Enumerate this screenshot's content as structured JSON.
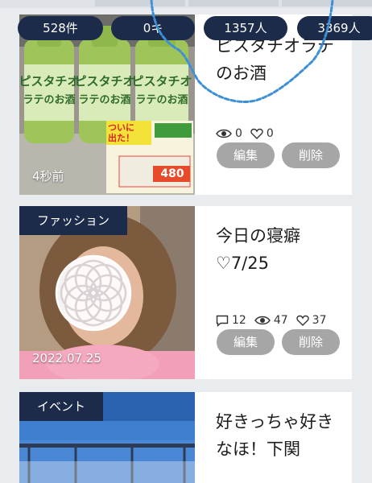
{
  "header_counts": [
    "528件",
    "0キ",
    "1357人",
    "3369人"
  ],
  "posts": [
    {
      "category": "",
      "title": "ピスタチオラテのお酒",
      "time": "4秒前",
      "stats": {
        "comments": "",
        "views": "0",
        "likes": "0"
      },
      "edit_label": "編集",
      "delete_label": "削除"
    },
    {
      "category": "ファッション",
      "title": "今日の寝癖♡7/25",
      "time": "2022.07.25",
      "stats": {
        "comments": "12",
        "views": "47",
        "likes": "37"
      },
      "edit_label": "編集",
      "delete_label": "削除"
    },
    {
      "category": "イベント",
      "title": "好きっちゃ好きなほ！下関",
      "time": "",
      "stats": {
        "comments": "",
        "views": "",
        "likes": ""
      },
      "edit_label": "",
      "delete_label": ""
    }
  ],
  "product_pop": {
    "line1": "ついに",
    "line2": "出た！",
    "price": "480"
  },
  "colors": {
    "navy": "#1c2b49",
    "button_gray": "#a6a6a6",
    "scribble": "#3d8fd6"
  }
}
